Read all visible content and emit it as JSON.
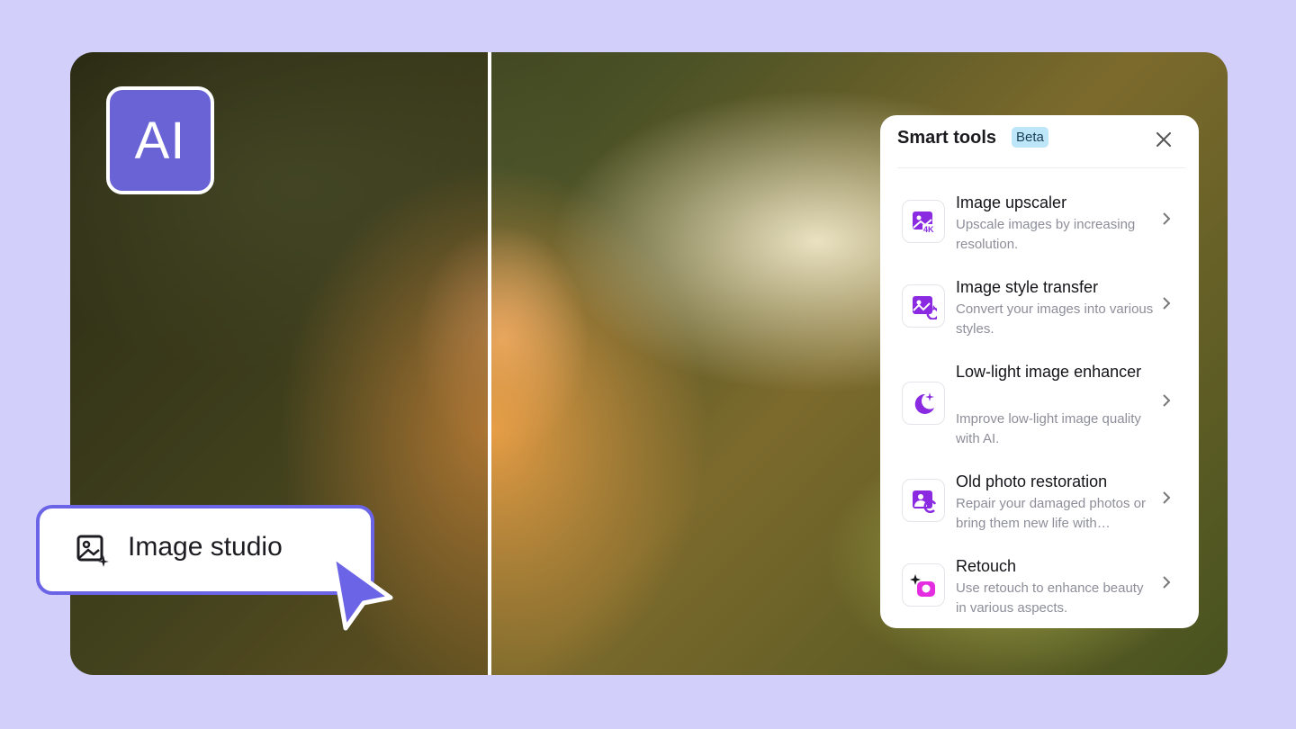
{
  "badge": {
    "text": "AI"
  },
  "studio": {
    "label": "Image studio"
  },
  "panel": {
    "title": "Smart tools",
    "beta": "Beta",
    "items": [
      {
        "title": "Image upscaler",
        "desc": "Upscale images by increasing resolution.",
        "icon": "image-4k-icon"
      },
      {
        "title": "Image style transfer",
        "desc": "Convert your images into various styles.",
        "icon": "style-transfer-icon"
      },
      {
        "title": "Low-light image enhancer",
        "desc": "Improve low-light image quality with AI.",
        "icon": "moon-sparkle-icon"
      },
      {
        "title": "Old photo restoration",
        "desc": "Repair your damaged photos or bring them new life with…",
        "icon": "photo-restore-icon"
      },
      {
        "title": "Retouch",
        "desc": "Use retouch to enhance beauty in various aspects.",
        "icon": "retouch-icon"
      }
    ]
  },
  "colors": {
    "accent": "#6b64e6",
    "background": "#d2d0fb",
    "icon_purple": "#8a2be2",
    "icon_pink": "#e42de0"
  }
}
